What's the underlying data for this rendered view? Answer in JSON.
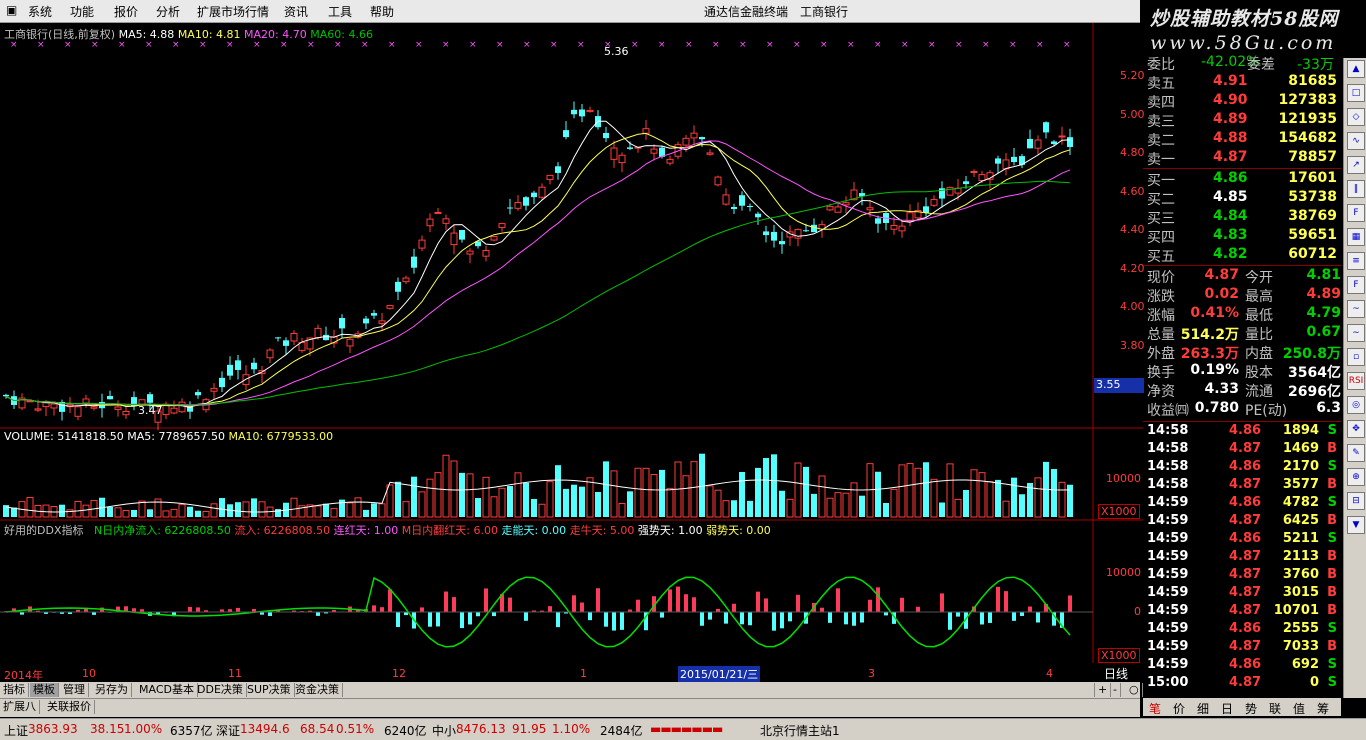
{
  "menu": {
    "items": [
      "系统",
      "功能",
      "报价",
      "分析",
      "扩展市场行情",
      "资讯",
      "工具",
      "帮助"
    ],
    "app_title": "通达信金融终端",
    "stock_name": "工商银行"
  },
  "banner": {
    "line1": "炒股辅助教材58股网",
    "line2": "www.58Gu.com"
  },
  "main_chart": {
    "header": "工商银行(日线,前复权)",
    "ma5": "MA5: 4.88",
    "ma10": "MA10: 4.81",
    "ma20": "MA20: 4.70",
    "ma60": "MA60: 4.66",
    "high_label": "5.36",
    "low_label": "3.47",
    "price_ticks": [
      "5.20",
      "5.00",
      "4.80",
      "4.60",
      "4.40",
      "4.20",
      "4.00",
      "3.80"
    ],
    "current_price_tag": "3.55"
  },
  "volume_chart": {
    "volume": "VOLUME: 5141818.50",
    "ma5": "MA5: 7789657.50",
    "ma10": "MA10: 6779533.00",
    "tick": "10000",
    "unit": "X1000"
  },
  "ddx_chart": {
    "name": "好用的DDX指标",
    "n_inflow": "N日内净流入: 6226808.50",
    "inflow": "流入: 6226808.50",
    "red_days": "连红天: 1.00",
    "m_red": "M日内翻红天: 6.00",
    "walk_days": "走能天: 0.00",
    "cow_days": "走牛天: 5.00",
    "strong_days": "强势天: 1.00",
    "weak_days": "弱势天: 0.00",
    "tick_top": "10000",
    "tick_zero": "0",
    "unit": "X1000"
  },
  "date_axis": {
    "labels": [
      "2014年",
      "10",
      "11",
      "12",
      "1",
      "3",
      "4"
    ],
    "cursor_date": "2015/01/21/三",
    "period_button": "日线"
  },
  "bottom_tabs": [
    "指标",
    "模板",
    "管理",
    "另存为",
    "MACD基本",
    "DDE决策",
    "SUP决策",
    "资金决策"
  ],
  "ext_tabs": [
    "扩展八",
    "关联报价"
  ],
  "quote_panel": {
    "top_row": {
      "label1": "委比",
      "value1": "-42.02%",
      "label2": "委差",
      "value2": "-33万"
    },
    "sells": [
      {
        "label": "卖五",
        "price": "4.91",
        "vol": "81685"
      },
      {
        "label": "卖四",
        "price": "4.90",
        "vol": "127383"
      },
      {
        "label": "卖三",
        "price": "4.89",
        "vol": "121935"
      },
      {
        "label": "卖二",
        "price": "4.88",
        "vol": "154682"
      },
      {
        "label": "卖一",
        "price": "4.87",
        "vol": "78857"
      }
    ],
    "buys": [
      {
        "label": "买一",
        "price": "4.86",
        "vol": "17601"
      },
      {
        "label": "买二",
        "price": "4.85",
        "vol": "53738"
      },
      {
        "label": "买三",
        "price": "4.84",
        "vol": "38769"
      },
      {
        "label": "买四",
        "price": "4.83",
        "vol": "59651"
      },
      {
        "label": "买五",
        "price": "4.82",
        "vol": "60712"
      }
    ],
    "stats": [
      {
        "l1": "现价",
        "v1": "4.87",
        "l2": "今开",
        "v2": "4.81"
      },
      {
        "l1": "涨跌",
        "v1": "0.02",
        "l2": "最高",
        "v2": "4.89"
      },
      {
        "l1": "涨幅",
        "v1": "0.41%",
        "l2": "最低",
        "v2": "4.79"
      },
      {
        "l1": "总量",
        "v1": "514.2万",
        "l2": "量比",
        "v2": "0.67"
      },
      {
        "l1": "外盘",
        "v1": "263.3万",
        "l2": "内盘",
        "v2": "250.8万"
      },
      {
        "l1": "换手",
        "v1": "0.19%",
        "l2": "股本",
        "v2": "3564亿"
      },
      {
        "l1": "净资",
        "v1": "4.33",
        "l2": "流通",
        "v2": "2696亿"
      },
      {
        "l1": "收益㈣",
        "v1": "0.780",
        "l2": "PE(动)",
        "v2": "6.3"
      }
    ]
  },
  "ticks": [
    {
      "time": "14:58",
      "price": "4.86",
      "vol": "1894",
      "bs": "S"
    },
    {
      "time": "14:58",
      "price": "4.87",
      "vol": "1469",
      "bs": "B"
    },
    {
      "time": "14:58",
      "price": "4.86",
      "vol": "2170",
      "bs": "S"
    },
    {
      "time": "14:58",
      "price": "4.87",
      "vol": "3577",
      "bs": "B"
    },
    {
      "time": "14:59",
      "price": "4.86",
      "vol": "4782",
      "bs": "S"
    },
    {
      "time": "14:59",
      "price": "4.87",
      "vol": "6425",
      "bs": "B"
    },
    {
      "time": "14:59",
      "price": "4.86",
      "vol": "5211",
      "bs": "S"
    },
    {
      "time": "14:59",
      "price": "4.87",
      "vol": "2113",
      "bs": "B"
    },
    {
      "time": "14:59",
      "price": "4.87",
      "vol": "3760",
      "bs": "B"
    },
    {
      "time": "14:59",
      "price": "4.87",
      "vol": "3015",
      "bs": "B"
    },
    {
      "time": "14:59",
      "price": "4.87",
      "vol": "10701",
      "bs": "B"
    },
    {
      "time": "14:59",
      "price": "4.86",
      "vol": "2555",
      "bs": "S"
    },
    {
      "time": "14:59",
      "price": "4.87",
      "vol": "7033",
      "bs": "B"
    },
    {
      "time": "14:59",
      "price": "4.86",
      "vol": "692",
      "bs": "S"
    },
    {
      "time": "15:00",
      "price": "4.87",
      "vol": "0",
      "bs": "S"
    }
  ],
  "right_tabs": [
    "笔",
    "价",
    "细",
    "日",
    "势",
    "联",
    "值",
    "筹"
  ],
  "status": {
    "sh_label": "上证",
    "sh_val": "3863.93",
    "sh_chg": "38.15",
    "sh_pct": "1.00%",
    "sh_amt": "6357亿",
    "sz_label": "深证",
    "sz_val": "13494.6",
    "sz_chg": "68.54",
    "sz_pct": "0.51%",
    "sz_amt": "6240亿",
    "zx_label": "中小",
    "zx_val": "8476.13",
    "zx_chg": "91.95",
    "zx_pct": "1.10%",
    "zx_amt": "2484亿",
    "server": "北京行情主站1"
  },
  "colors": {
    "up": "#ff3b3b",
    "down": "#54ffff",
    "ma5": "#ffffff",
    "ma10": "#ffff54",
    "ma20": "#ff54ff",
    "ma60": "#00c000"
  }
}
